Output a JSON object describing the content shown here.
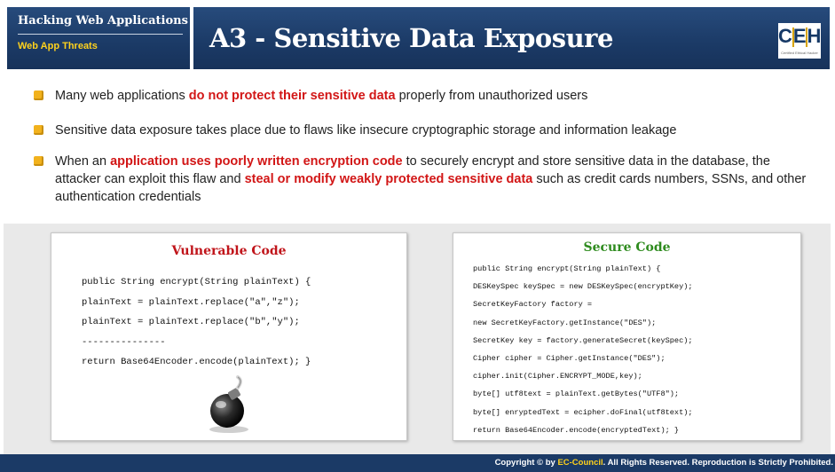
{
  "header": {
    "course": "Hacking Web Applications",
    "module": "Web App Threats",
    "title": "A3 - Sensitive Data Exposure",
    "logo_letters": "CEH",
    "logo_tagline": "Certified   Ethical   Hacker"
  },
  "bullets": [
    {
      "parts": [
        {
          "text": "Many web applications ",
          "hl": false
        },
        {
          "text": "do not protect their sensitive data",
          "hl": true
        },
        {
          "text": " properly from unauthorized users",
          "hl": false
        }
      ]
    },
    {
      "parts": [
        {
          "text": "Sensitive data exposure takes place due to flaws like insecure cryptographic storage and information leakage",
          "hl": false
        }
      ]
    },
    {
      "parts": [
        {
          "text": "When an ",
          "hl": false
        },
        {
          "text": "application uses poorly written encryption code",
          "hl": true
        },
        {
          "text": " to securely encrypt and store sensitive data in the database, the attacker can exploit this flaw and ",
          "hl": false
        },
        {
          "text": "steal or modify weakly protected sensitive data",
          "hl": true
        },
        {
          "text": " such as credit cards numbers, SSNs, and other authentication credentials",
          "hl": false
        }
      ]
    }
  ],
  "vulnerable": {
    "title": "Vulnerable Code",
    "title_color": "#c0141a",
    "lines": [
      "public String encrypt(String plainText) {",
      "plainText = plainText.replace(\"a\",\"z\");",
      "plainText = plainText.replace(\"b\",\"y\");",
      "---------------",
      "return Base64Encoder.encode(plainText); }"
    ],
    "icon": "bomb-icon"
  },
  "secure": {
    "title": "Secure Code",
    "title_color": "#2e8b1e",
    "lines": [
      "public String encrypt(String plainText) {",
      "DESKeySpec keySpec = new DESKeySpec(encryptKey);",
      "SecretKeyFactory factory =",
      "new SecretKeyFactory.getInstance(\"DES\");",
      "SecretKey key = factory.generateSecret(keySpec);",
      "Cipher cipher = Cipher.getInstance(\"DES\");",
      "cipher.init(Cipher.ENCRYPT_MODE,key);",
      "byte[] utf8text = plainText.getBytes(\"UTF8\");",
      "byte[] enryptedText = ecipher.doFinal(utf8text);",
      "return Base64Encoder.encode(encryptedText); }"
    ]
  },
  "footer": {
    "prefix": "Copyright © by ",
    "brand": "EC-Council",
    "suffix": ". All Rights Reserved. Reproduction is Strictly Prohibited."
  },
  "colors": {
    "header_bg": "#1b3a66",
    "accent_yellow": "#ffd21c",
    "highlight_red": "#d21616",
    "bullet": "#f2b21d"
  }
}
